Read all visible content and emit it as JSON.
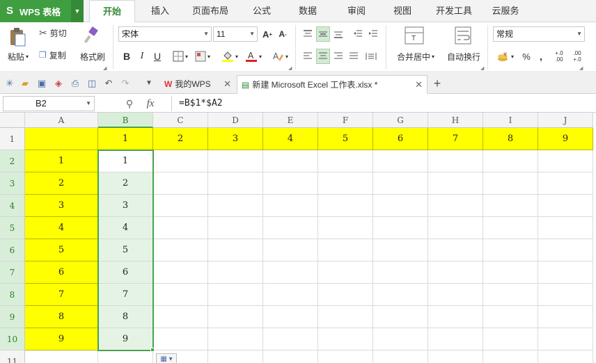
{
  "app": {
    "title": "WPS 表格"
  },
  "menu": {
    "tabs": [
      {
        "label": "开始",
        "active": true
      },
      {
        "label": "插入"
      },
      {
        "label": "页面布局"
      },
      {
        "label": "公式"
      },
      {
        "label": "数据"
      },
      {
        "label": "审阅"
      },
      {
        "label": "视图"
      },
      {
        "label": "开发工具"
      },
      {
        "label": "云服务"
      }
    ]
  },
  "ribbon": {
    "paste": "粘贴",
    "cut": "剪切",
    "copy": "复制",
    "format_painter": "格式刷",
    "font_name": "宋体",
    "font_size": "11",
    "bold": "B",
    "italic": "I",
    "underline": "U",
    "merge_center": "合并居中",
    "wrap_text": "自动换行",
    "number_format": "常规",
    "percent": "%",
    "comma": ",",
    "inc_decimal": "+.0\n.00",
    "dec_decimal": ".00\n+.0"
  },
  "quick_access": {
    "tabs": [
      {
        "label": "我的WPS",
        "active": false
      },
      {
        "label": "新建 Microsoft Excel 工作表.xlsx *",
        "active": true
      }
    ],
    "add": "+"
  },
  "formula_bar": {
    "name_box": "B2",
    "fx": "fx",
    "formula": "=B$1*$A2"
  },
  "sheet": {
    "columns": [
      "A",
      "B",
      "C",
      "D",
      "E",
      "F",
      "G",
      "H",
      "I",
      "J"
    ],
    "rows": [
      "1",
      "2",
      "3",
      "4",
      "5",
      "6",
      "7",
      "8",
      "9",
      "10",
      "11"
    ],
    "cells": [
      [
        "",
        "1",
        "2",
        "3",
        "4",
        "5",
        "6",
        "7",
        "8",
        "9"
      ],
      [
        "1",
        "1",
        "",
        "",
        "",
        "",
        "",
        "",
        "",
        ""
      ],
      [
        "2",
        "2",
        "",
        "",
        "",
        "",
        "",
        "",
        "",
        ""
      ],
      [
        "3",
        "3",
        "",
        "",
        "",
        "",
        "",
        "",
        "",
        ""
      ],
      [
        "4",
        "4",
        "",
        "",
        "",
        "",
        "",
        "",
        "",
        ""
      ],
      [
        "5",
        "5",
        "",
        "",
        "",
        "",
        "",
        "",
        "",
        ""
      ],
      [
        "6",
        "6",
        "",
        "",
        "",
        "",
        "",
        "",
        "",
        ""
      ],
      [
        "7",
        "7",
        "",
        "",
        "",
        "",
        "",
        "",
        "",
        ""
      ],
      [
        "8",
        "8",
        "",
        "",
        "",
        "",
        "",
        "",
        "",
        ""
      ],
      [
        "9",
        "9",
        "",
        "",
        "",
        "",
        "",
        "",
        "",
        ""
      ],
      [
        "",
        "",
        "",
        "",
        "",
        "",
        "",
        "",
        "",
        ""
      ]
    ],
    "highlight_color": "#ffff00",
    "selection_color": "#4aa14a",
    "selected_range": "B2:B10",
    "active_cell": "B2"
  }
}
